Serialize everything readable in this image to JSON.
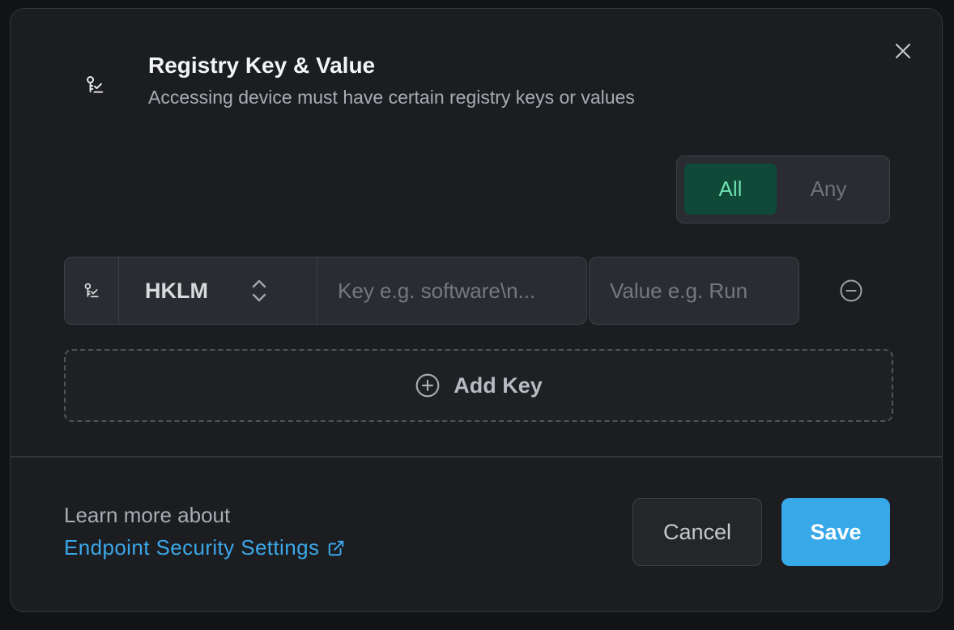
{
  "header": {
    "icon": "registry-key-check-icon",
    "title": "Registry Key & Value",
    "subtitle": "Accessing device must have certain registry keys or values"
  },
  "match_toggle": {
    "options": [
      "All",
      "Any"
    ],
    "selected": "All"
  },
  "key_row": {
    "icon": "registry-key-check-icon",
    "hive": "HKLM",
    "key_placeholder": "Key e.g. software\\n...",
    "value_placeholder": "Value e.g. Run"
  },
  "add_key_label": "Add Key",
  "footer": {
    "learn_more": "Learn more about",
    "link_text": "Endpoint Security Settings",
    "cancel_label": "Cancel",
    "save_label": "Save"
  },
  "colors": {
    "accent": "#38a9e8",
    "toggle_active_bg": "#0e4a37",
    "toggle_active_text": "#6ee0b0",
    "link": "#3ba7e8"
  }
}
